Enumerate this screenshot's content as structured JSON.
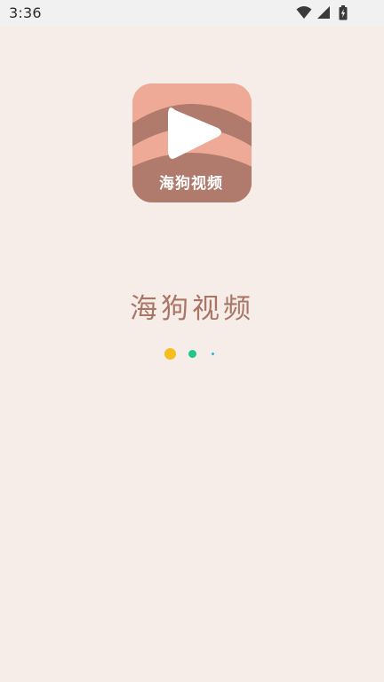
{
  "status_bar": {
    "time": "3:36",
    "icons": [
      "wifi-icon",
      "signal-icon",
      "battery-charging-icon"
    ]
  },
  "splash": {
    "icon_label": "海狗视频",
    "app_name": "海狗视频",
    "loading_dots": [
      {
        "color": "#f6be1f"
      },
      {
        "color": "#21c786"
      },
      {
        "color": "#2fb0de"
      }
    ]
  },
  "colors": {
    "background": "#f6ede9",
    "icon_peach": "#eeaa97",
    "icon_brown": "#b07a6c",
    "app_name_text": "#a97565"
  }
}
